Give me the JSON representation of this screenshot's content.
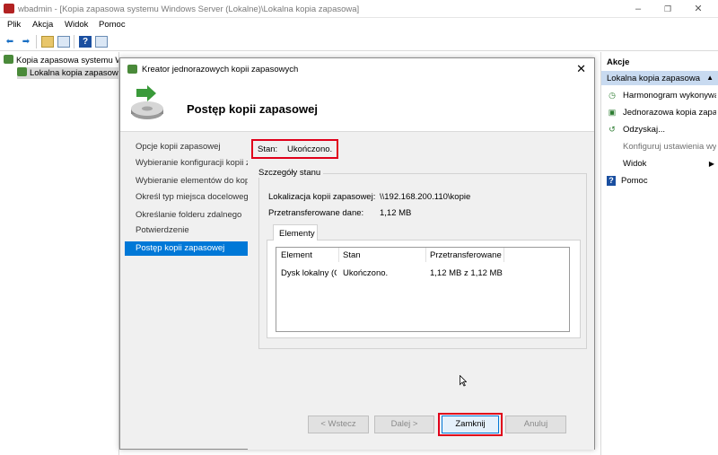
{
  "window": {
    "title": "wbadmin - [Kopia zapasowa systemu Windows Server (Lokalne)\\Lokalna kopia zapasowa]",
    "min_icon": "minimize-icon",
    "max_icon": "restore-icon",
    "close_icon": "close-icon"
  },
  "menu": [
    "Plik",
    "Akcja",
    "Widok",
    "Pomoc"
  ],
  "tree": {
    "root": "Kopia zapasowa systemu Windows Server (Lokalne)",
    "child": "Lokalna kopia zapasowa"
  },
  "actions": {
    "header": "Akcje",
    "subheader": "Lokalna kopia zapasowa",
    "items": [
      {
        "label": "Harmonogram wykonywania kopii zapasowych...",
        "icon": "schedule-icon",
        "disabled": false
      },
      {
        "label": "Jednorazowa kopia zapasowa...",
        "icon": "backup-icon",
        "disabled": false
      },
      {
        "label": "Odzyskaj...",
        "icon": "recover-icon",
        "disabled": false
      },
      {
        "label": "Konfiguruj ustawienia wydajności...",
        "icon": "",
        "disabled": true
      },
      {
        "label": "Widok",
        "icon": "",
        "disabled": false,
        "submenu": true
      },
      {
        "label": "Pomoc",
        "icon": "help-icon",
        "disabled": false
      }
    ]
  },
  "dialog": {
    "title": "Kreator jednorazowych kopii zapasowych",
    "header": "Postęp kopii zapasowej",
    "steps": [
      "Opcje kopii zapasowej",
      "Wybieranie konfiguracji kopii zapasowej",
      "Wybieranie elementów do kopii zapasowej",
      "Określ typ miejsca docelowego",
      "Określanie folderu zdalnego",
      "Potwierdzenie",
      "Postęp kopii zapasowej"
    ],
    "active_step": 6,
    "status_label": "Stan:",
    "status_value": "Ukończono.",
    "details_title": "Szczegóły stanu",
    "location_label": "Lokalizacja kopii zapasowej:",
    "location_value": "\\\\192.168.200.110\\kopie",
    "transferred_label": "Przetransferowane dane:",
    "transferred_value": "1,12 MB",
    "tab_label": "Elementy",
    "columns": [
      "Element",
      "Stan",
      "Przetransferowane dane"
    ],
    "rows": [
      {
        "element": "Dysk lokalny (C:)",
        "status": "Ukończono.",
        "transferred": "1,12 MB z 1,12 MB"
      }
    ],
    "buttons": {
      "back": "< Wstecz",
      "next": "Dalej >",
      "close": "Zamknij",
      "cancel": "Anuluj"
    }
  },
  "colors": {
    "highlight": "#e0001a",
    "accent": "#0078d7",
    "actions_sub_bg": "#c8daf0"
  }
}
